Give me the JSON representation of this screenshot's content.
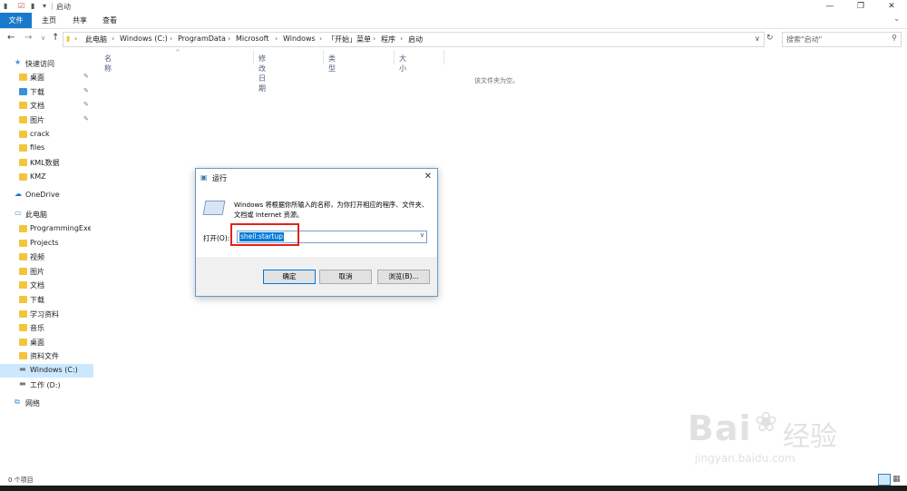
{
  "window": {
    "title": "启动",
    "controls": [
      "—",
      "❐",
      "✕"
    ]
  },
  "ribbon": {
    "tabs": [
      "文件",
      "主页",
      "共享",
      "查看"
    ],
    "expand": "⌄"
  },
  "address": {
    "crumbs": [
      "此电脑",
      "Windows (C:)",
      "ProgramData",
      "Microsoft",
      "Windows",
      "「开始」菜单",
      "程序",
      "启动"
    ],
    "search_placeholder": "搜索\"启动\""
  },
  "nav": {
    "items": [
      {
        "label": "快速访问",
        "icon": "star-icon",
        "pinned": false
      },
      {
        "label": "桌面",
        "icon": "folder-icon",
        "pinned": true
      },
      {
        "label": "下载",
        "icon": "download-folder-icon",
        "pinned": true
      },
      {
        "label": "文档",
        "icon": "folder-icon",
        "pinned": true
      },
      {
        "label": "图片",
        "icon": "folder-icon",
        "pinned": true
      },
      {
        "label": "crack",
        "icon": "folder-icon",
        "pinned": false
      },
      {
        "label": "files",
        "icon": "folder-icon",
        "pinned": false
      },
      {
        "label": "KML数据",
        "icon": "folder-icon",
        "pinned": false
      },
      {
        "label": "KMZ",
        "icon": "folder-icon",
        "pinned": false
      },
      {
        "label": "OneDrive",
        "icon": "cloud-icon",
        "pinned": false
      },
      {
        "label": "此电脑",
        "icon": "computer-icon",
        "pinned": false
      },
      {
        "label": "ProgrammingExer",
        "icon": "folder-icon",
        "pinned": false
      },
      {
        "label": "Projects",
        "icon": "folder-icon",
        "pinned": false
      },
      {
        "label": "视频",
        "icon": "folder-icon",
        "pinned": false
      },
      {
        "label": "图片",
        "icon": "folder-icon",
        "pinned": false
      },
      {
        "label": "文档",
        "icon": "folder-icon",
        "pinned": false
      },
      {
        "label": "下载",
        "icon": "folder-icon",
        "pinned": false
      },
      {
        "label": "学习资料",
        "icon": "folder-icon",
        "pinned": false
      },
      {
        "label": "音乐",
        "icon": "folder-icon",
        "pinned": false
      },
      {
        "label": "桌面",
        "icon": "folder-icon",
        "pinned": false
      },
      {
        "label": "资料文件",
        "icon": "folder-icon",
        "pinned": false
      },
      {
        "label": "Windows (C:)",
        "icon": "drive-icon",
        "pinned": false
      },
      {
        "label": "工作 (D:)",
        "icon": "drive-icon",
        "pinned": false
      },
      {
        "label": "网络",
        "icon": "network-icon",
        "pinned": false
      }
    ]
  },
  "columns": {
    "name": "名称",
    "modified": "修改日期",
    "type": "类型",
    "size": "大小"
  },
  "content": {
    "empty_text": "该文件夹为空。"
  },
  "status": {
    "item_count": "0 个项目"
  },
  "run_dialog": {
    "title": "运行",
    "message": "Windows 将根据你所输入的名称，为你打开相应的程序、文件夹、文档或 Internet 资源。",
    "open_label": "打开(O):",
    "input_value": "shell:startup",
    "ok": "确定",
    "cancel": "取消",
    "browse": "浏览(B)..."
  },
  "watermark": {
    "brand": "Bai",
    "brand_cn": "经验",
    "url": "jingyan.baidu.com"
  },
  "colors": {
    "accent": "#1979ca",
    "selection": "#cce8ff",
    "highlight_box": "#e2231a",
    "folder": "#f3c53d"
  }
}
